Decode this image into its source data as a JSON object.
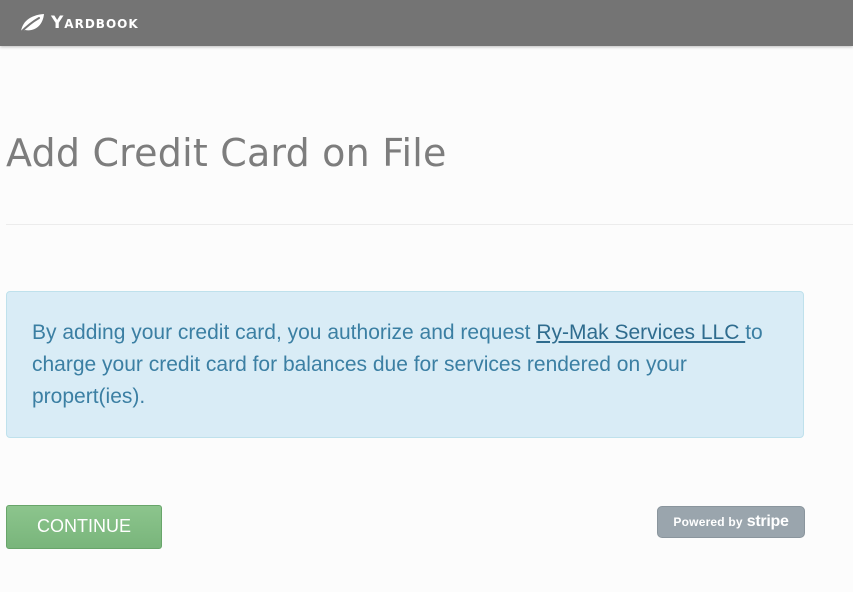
{
  "header": {
    "brand": "Yardbook",
    "brand_icon": "leaf-icon",
    "background": "#747474"
  },
  "page": {
    "title": "Add Credit Card on File"
  },
  "alert": {
    "text_before": "By adding your credit card, you authorize and request ",
    "company_link": "Ry-Mak Services LLC ",
    "text_after": "to charge your credit card for balances due for services rendered on your propert(ies).",
    "background": "#d9ecf6",
    "text_color": "#3b7fa3"
  },
  "actions": {
    "continue_label": "CONTINUE",
    "continue_color": "#7fbb81"
  },
  "stripe_badge": {
    "powered_by": "Powered by",
    "wordmark": "stripe",
    "background": "#9aa5ad"
  }
}
